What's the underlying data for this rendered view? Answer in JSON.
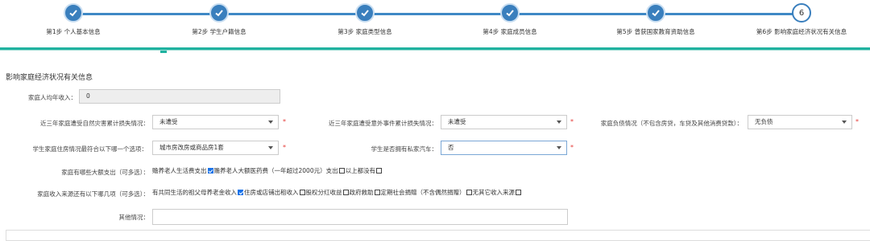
{
  "stepper": {
    "steps": [
      {
        "label": "第1步 个人基本信息",
        "status": "done"
      },
      {
        "label": "第2步 学生户籍信息",
        "status": "done"
      },
      {
        "label": "第3步 家庭类型信息",
        "status": "done"
      },
      {
        "label": "第4步 家庭成员信息",
        "status": "done"
      },
      {
        "label": "第5步 曾获国家教育资助信息",
        "status": "done"
      },
      {
        "label": "第6步 影响家庭经济状况有关信息",
        "status": "current",
        "number": "6"
      }
    ],
    "accent": "#3a7fbd",
    "divider_color": "#20b2a0"
  },
  "form": {
    "title": "影响家庭经济状况有关信息",
    "income": {
      "label": "家庭人均年收入：",
      "value": "0"
    },
    "disaster": {
      "label": "近三年家庭遭受自然灾害累计损失情况：",
      "value": "未遭受"
    },
    "accident": {
      "label": "近三年家庭遭受意外事件累计损失情况：",
      "value": "未遭受"
    },
    "debt": {
      "label": "家庭负债情况（不包含房贷，车贷及其他消费贷款）：",
      "value": "无负债"
    },
    "housing": {
      "label": "学生家庭住房情况最符合以下哪一个选项：",
      "value": "城市房改房或商品房1套"
    },
    "car": {
      "label": "学生是否拥有私家汽车：",
      "value": "否"
    },
    "expenses": {
      "label": "家庭有哪些大额支出（可多选）：",
      "options": [
        {
          "text": "赡养老人生活费支出",
          "checked": true
        },
        {
          "text": "赡养老人大额医药费（一年超过2000元）支出",
          "checked": false
        },
        {
          "text": "以上都没有",
          "checked": false
        }
      ]
    },
    "income_sources": {
      "label": "家庭收入来源还有以下哪几项（可多选）：",
      "options": [
        {
          "text": "有共同生活的祖父母养老金收入",
          "checked": true
        },
        {
          "text": "住房或店铺出租收入",
          "checked": false
        },
        {
          "text": "股权分红收益",
          "checked": false
        },
        {
          "text": "政府救助",
          "checked": false
        },
        {
          "text": "定期社会捐赠（不含偶然捐赠）",
          "checked": false
        },
        {
          "text": "无其它收入来源",
          "checked": false
        }
      ]
    },
    "other": {
      "label": "其他情况：",
      "value": ""
    },
    "required_mark": "*"
  }
}
